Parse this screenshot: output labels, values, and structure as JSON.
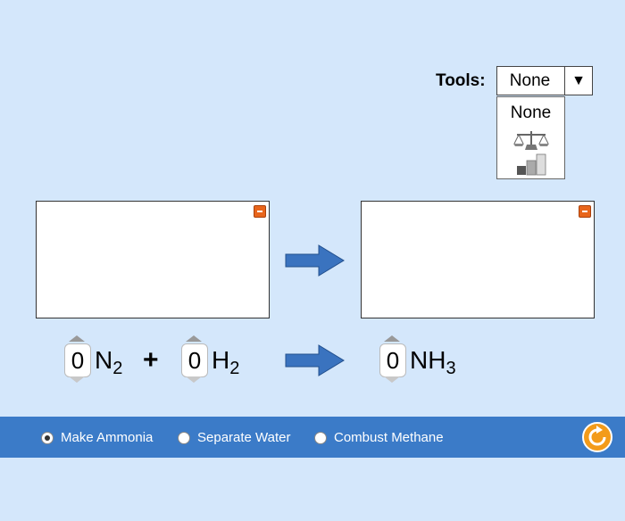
{
  "tools": {
    "label": "Tools:",
    "selected": "None",
    "options": [
      "None",
      "balance-scale",
      "bar-chart"
    ],
    "option_none_label": "None"
  },
  "equation": {
    "reactants": [
      {
        "coefficient": "0",
        "symbol": "N",
        "subscript": "2"
      },
      {
        "coefficient": "0",
        "symbol": "H",
        "subscript": "2"
      }
    ],
    "plus": "+",
    "products": [
      {
        "coefficient": "0",
        "symbol": "NH",
        "subscript": "3"
      }
    ]
  },
  "reactions": {
    "options": [
      "Make Ammonia",
      "Separate Water",
      "Combust Methane"
    ],
    "selected": "Make Ammonia"
  },
  "colors": {
    "background": "#d4e7fb",
    "footer": "#3b7bc8",
    "arrow": "#3a73bf",
    "minimize": "#e8651b",
    "reset": "#f39b1a"
  }
}
